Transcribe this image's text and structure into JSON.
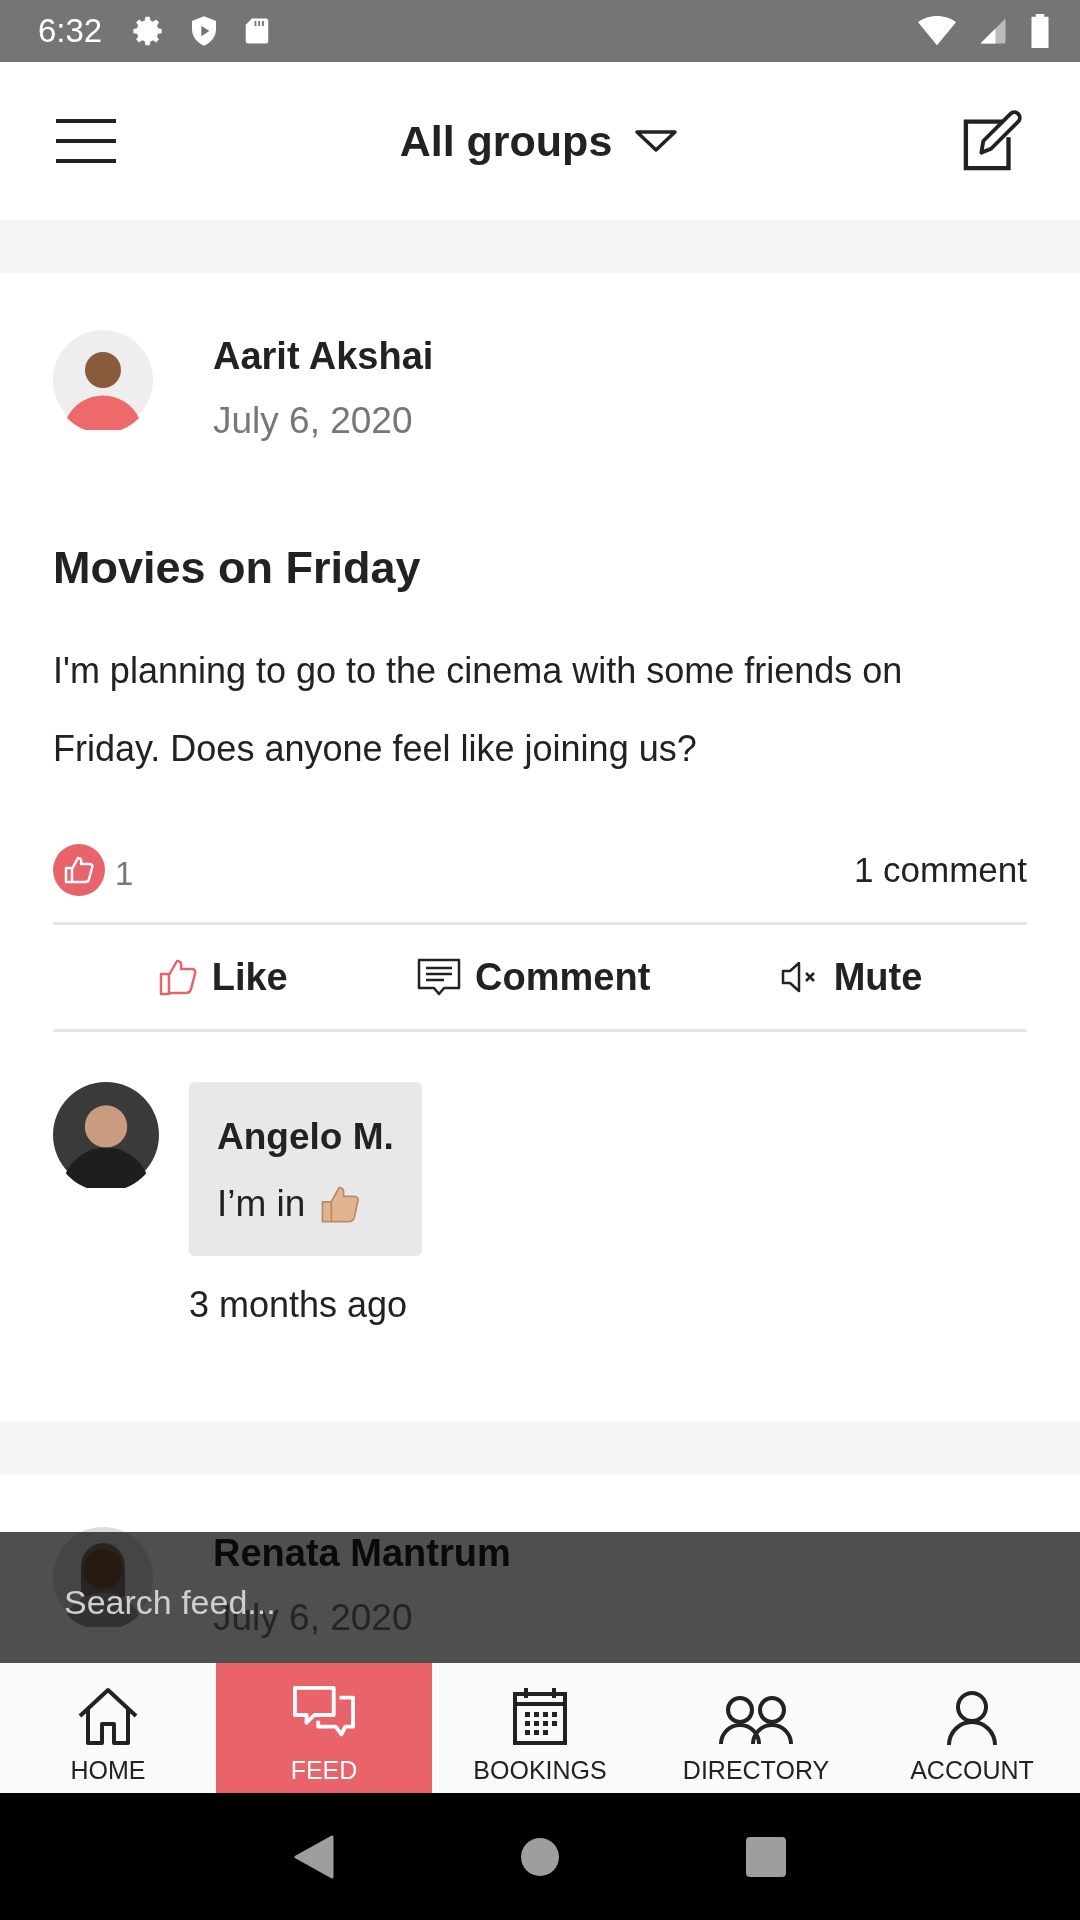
{
  "status_bar": {
    "time": "6:32"
  },
  "header": {
    "title": "All groups"
  },
  "post": {
    "author": "Aarit Akshai",
    "date": "July 6, 2020",
    "title": "Movies on Friday",
    "body": "I'm planning to go to the cinema with some friends on Friday. Does anyone feel like joining us?",
    "like_count": "1",
    "comment_count": "1 comment",
    "actions": [
      {
        "kind": "like",
        "label": "Like"
      },
      {
        "kind": "comment",
        "label": "Comment"
      },
      {
        "kind": "mute",
        "label": "Mute"
      }
    ],
    "comments": [
      {
        "author": "Angelo M.",
        "text": "I’m in",
        "time": "3 months ago"
      }
    ]
  },
  "next_post": {
    "author": "Renata Mantrum",
    "date": "July 6, 2020"
  },
  "search": {
    "placeholder": "Search feed..."
  },
  "nav": [
    {
      "kind": "home",
      "label": "HOME",
      "selected": false
    },
    {
      "kind": "feed",
      "label": "FEED",
      "selected": true
    },
    {
      "kind": "bookings",
      "label": "BOOKINGS",
      "selected": false
    },
    {
      "kind": "directory",
      "label": "DIRECTORY",
      "selected": false
    },
    {
      "kind": "account",
      "label": "ACCOUNT",
      "selected": false
    }
  ]
}
